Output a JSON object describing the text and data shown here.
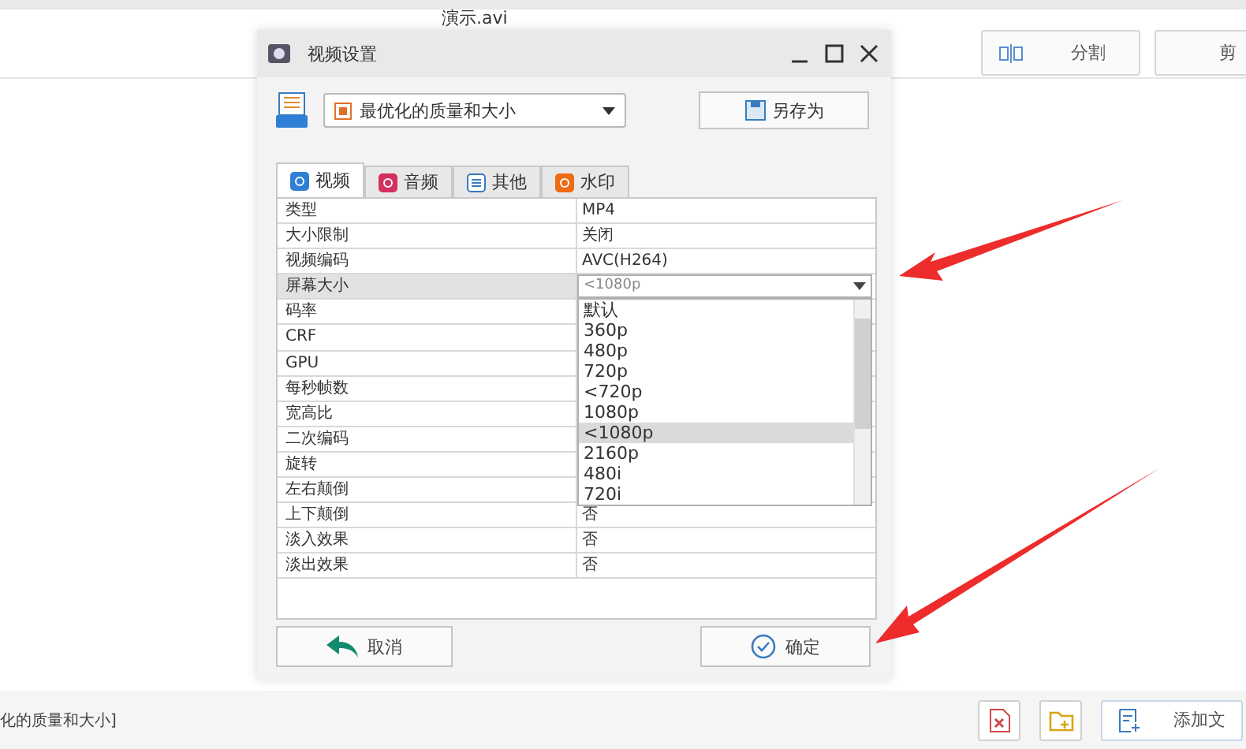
{
  "background": {
    "file_title": "演示.avi",
    "toolbar_buttons": [
      {
        "kind": "split",
        "label": "分割"
      },
      {
        "kind": "cut",
        "label": "剪"
      }
    ],
    "status_text": "化的质量和大小]",
    "bottom_buttons": [
      {
        "kind": "delete"
      },
      {
        "kind": "folder"
      },
      {
        "kind": "add",
        "label": "添加文"
      }
    ]
  },
  "dialog": {
    "title": "视频设置",
    "preset": "最优化的质量和大小",
    "save_as": "另存为",
    "tabs": [
      {
        "kind": "video",
        "label": "视频",
        "selected": true
      },
      {
        "kind": "audio",
        "label": "音频",
        "selected": false
      },
      {
        "kind": "other",
        "label": "其他",
        "selected": false
      },
      {
        "kind": "watermark",
        "label": "水印",
        "selected": false
      }
    ],
    "rows": [
      {
        "name": "类型",
        "value": "MP4",
        "selected": false
      },
      {
        "name": "大小限制",
        "value": "关闭",
        "selected": false
      },
      {
        "name": "视频编码",
        "value": "AVC(H264)",
        "selected": false
      },
      {
        "name": "屏幕大小",
        "selected": true,
        "dropdown": {
          "value": "<1080p",
          "options": [
            {
              "label": "默认",
              "selected": false
            },
            {
              "label": "360p",
              "selected": false
            },
            {
              "label": "480p",
              "selected": false
            },
            {
              "label": "720p",
              "selected": false
            },
            {
              "label": "<720p",
              "selected": false
            },
            {
              "label": "1080p",
              "selected": false
            },
            {
              "label": "<1080p",
              "selected": true
            },
            {
              "label": "2160p",
              "selected": false
            },
            {
              "label": "480i",
              "selected": false
            },
            {
              "label": "720i",
              "selected": false
            }
          ]
        }
      },
      {
        "name": "码率",
        "selected": false
      },
      {
        "name": "CRF",
        "selected": false
      },
      {
        "name": "GPU",
        "selected": false
      },
      {
        "name": "每秒帧数",
        "selected": false
      },
      {
        "name": "宽高比",
        "selected": false
      },
      {
        "name": "二次编码",
        "selected": false
      },
      {
        "name": "旋转",
        "selected": false
      },
      {
        "name": "左右颠倒",
        "selected": false
      },
      {
        "name": "上下颠倒",
        "value": "否",
        "selected": false
      },
      {
        "name": "淡入效果",
        "value": "否",
        "selected": false
      },
      {
        "name": "淡出效果",
        "value": "否",
        "selected": false
      }
    ],
    "cancel": "取消",
    "ok": "确定"
  }
}
